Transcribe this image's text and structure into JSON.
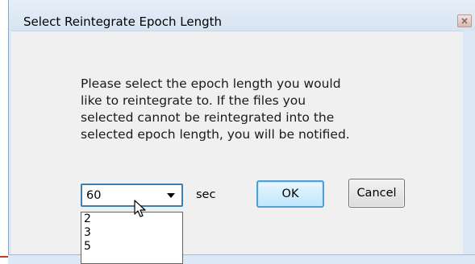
{
  "window": {
    "title": "Select Reintegrate Epoch Length"
  },
  "dialog": {
    "message": "Please select the epoch length you would\nlike to reintegrate to.  If the files you\nselected cannot be reintegrated into the\nselected epoch length, you will be notified.",
    "epoch_select": {
      "selected_value": "60",
      "unit_label": "sec",
      "options": [
        "2",
        "3",
        "5"
      ]
    },
    "ok_label": "OK",
    "cancel_label": "Cancel"
  },
  "icons": {
    "close": "close-icon",
    "dropdown": "chevron-down-icon",
    "cursor": "pointer-cursor-icon"
  },
  "colors": {
    "frame": "#dce8f5",
    "client": "#f0f0f0",
    "focus_border": "#3c7fb1",
    "ok_button": "#bee6fd"
  }
}
